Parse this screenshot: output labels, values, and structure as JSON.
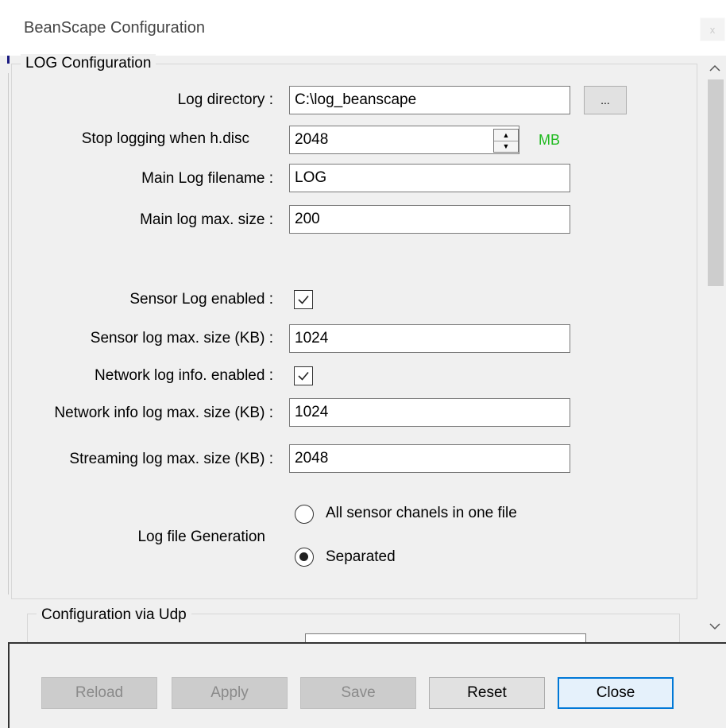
{
  "window": {
    "title": "BeanScape Configuration",
    "close_label": "x"
  },
  "log_group": {
    "legend": "LOG Configuration",
    "log_directory": {
      "label": "Log directory :",
      "value": "C:\\log_beanscape",
      "browse_label": "..."
    },
    "stop_logging": {
      "label": "Stop logging when h.disc",
      "value": "2048",
      "unit": "MB"
    },
    "main_log_filename": {
      "label": "Main Log filename :",
      "value": "LOG"
    },
    "main_log_max_size": {
      "label": "Main log max. size :",
      "value": "200"
    },
    "sensor_log_enabled": {
      "label": "Sensor Log enabled :",
      "checked": true
    },
    "sensor_log_max_size": {
      "label": "Sensor log max. size (KB) :",
      "value": "1024"
    },
    "network_log_enabled": {
      "label": "Network log info. enabled :",
      "checked": true
    },
    "network_info_log_max_size": {
      "label": "Network info log max. size (KB) :",
      "value": "1024"
    },
    "streaming_log_max_size": {
      "label": "Streaming log max. size (KB) :",
      "value": "2048"
    },
    "log_file_generation": {
      "label": "Log file Generation",
      "options": [
        "All sensor chanels in one file",
        "Separated"
      ],
      "selected": "Separated"
    }
  },
  "udp_group": {
    "legend": "Configuration via Udp"
  },
  "buttons": {
    "reload": "Reload",
    "apply": "Apply",
    "save": "Save",
    "reset": "Reset",
    "close": "Close"
  },
  "icons": {
    "spin_up": "spin-up-icon",
    "spin_down": "spin-down-icon",
    "check": "checkmark-icon",
    "scroll_up": "chevron-up-icon",
    "scroll_down": "chevron-down-icon"
  },
  "colors": {
    "unit_text": "#1fba1f",
    "default_button_border": "#0078d7"
  }
}
